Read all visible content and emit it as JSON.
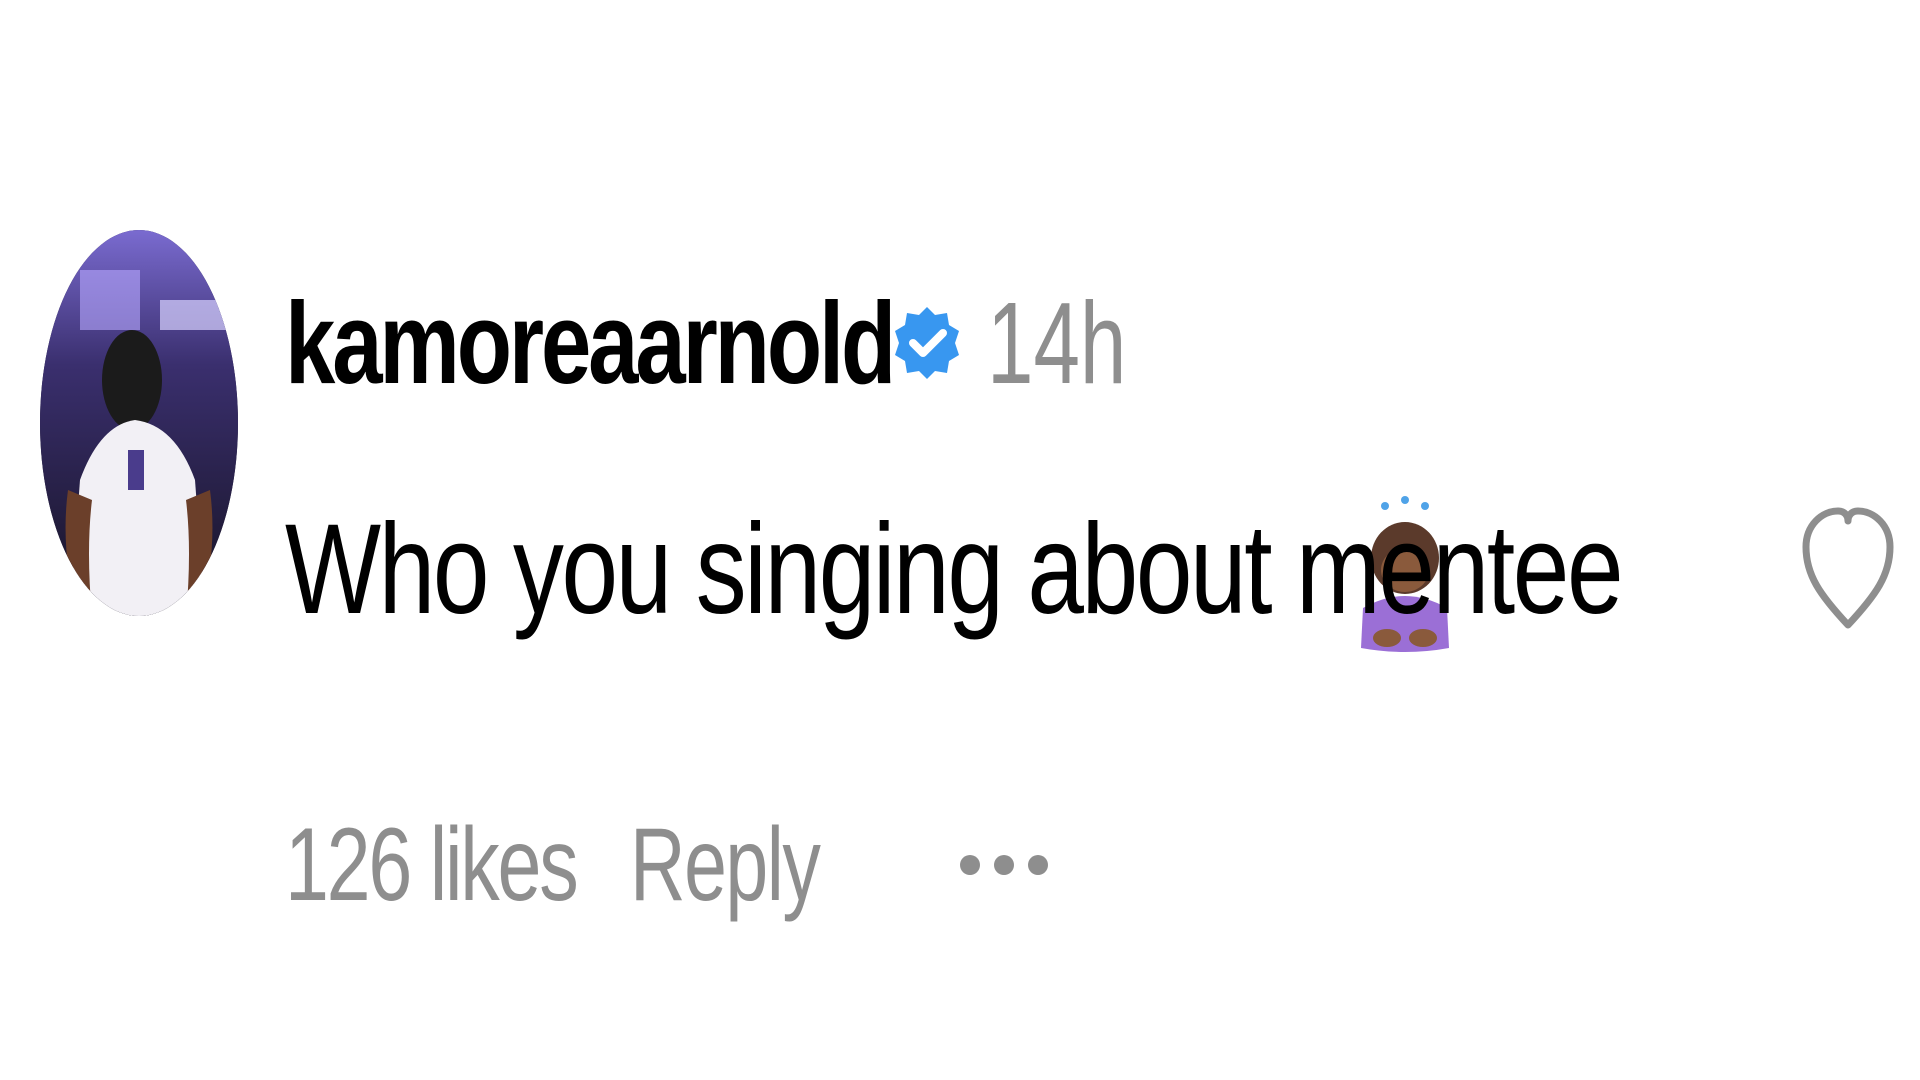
{
  "comment": {
    "username": "kamoreaarnold",
    "verified": true,
    "verified_badge_color": "#3897f0",
    "timestamp": "14h",
    "text": "Who you singing about mentee",
    "emoji": "person-bowing-emoji",
    "like_icon": "heart-outline-icon",
    "likes_label": "126 likes",
    "reply_label": "Reply",
    "more_icon": "more-options-icon",
    "avatar_icon": "avatar-photo-basketball-player"
  },
  "colors": {
    "text_primary": "#000000",
    "text_secondary": "#8e8e8e",
    "background": "#ffffff"
  }
}
